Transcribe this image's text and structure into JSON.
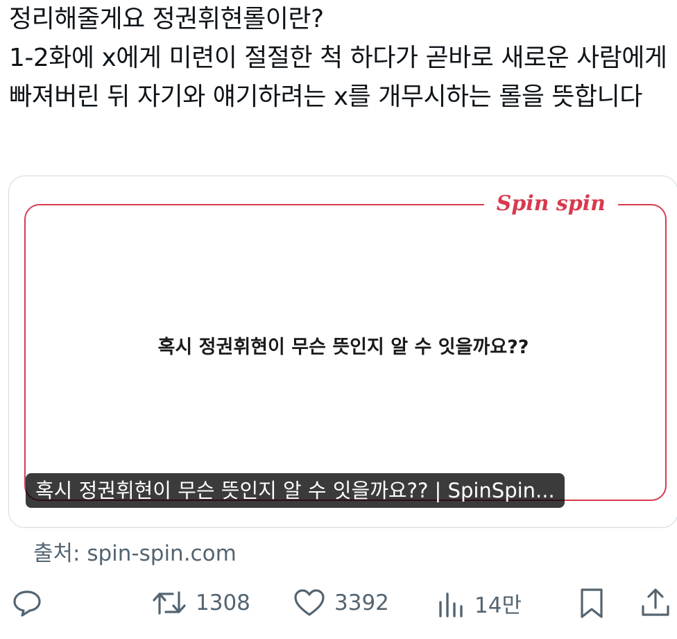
{
  "tweet": {
    "text": "정리해줄게요 정권휘현롤이란?\n1-2화에 x에게 미련이 절절한 척 하다가 곧바로 새로운 사람에게 빠져버린 뒤 자기와 얘기하려는 x를 개무시하는 롤을 뜻합니다"
  },
  "card": {
    "logo": "Spin spin",
    "question": "혹시 정권휘현이 무슨 뜻인지 알 수 잇을까요??",
    "title": "혹시 정권휘현이 무슨 뜻인지 알 수 잇을까요?? | SpinSpin..."
  },
  "source": "출처: spin-spin.com",
  "actions": {
    "reply": {
      "icon": "reply-icon"
    },
    "retweet": {
      "icon": "retweet-icon",
      "count": "1308"
    },
    "like": {
      "icon": "heart-icon",
      "count": "3392"
    },
    "views": {
      "icon": "views-icon",
      "count": "14만"
    },
    "bookmark": {
      "icon": "bookmark-icon"
    },
    "share": {
      "icon": "share-icon"
    }
  },
  "colors": {
    "brand": "#d83a4e",
    "muted": "#536471"
  }
}
